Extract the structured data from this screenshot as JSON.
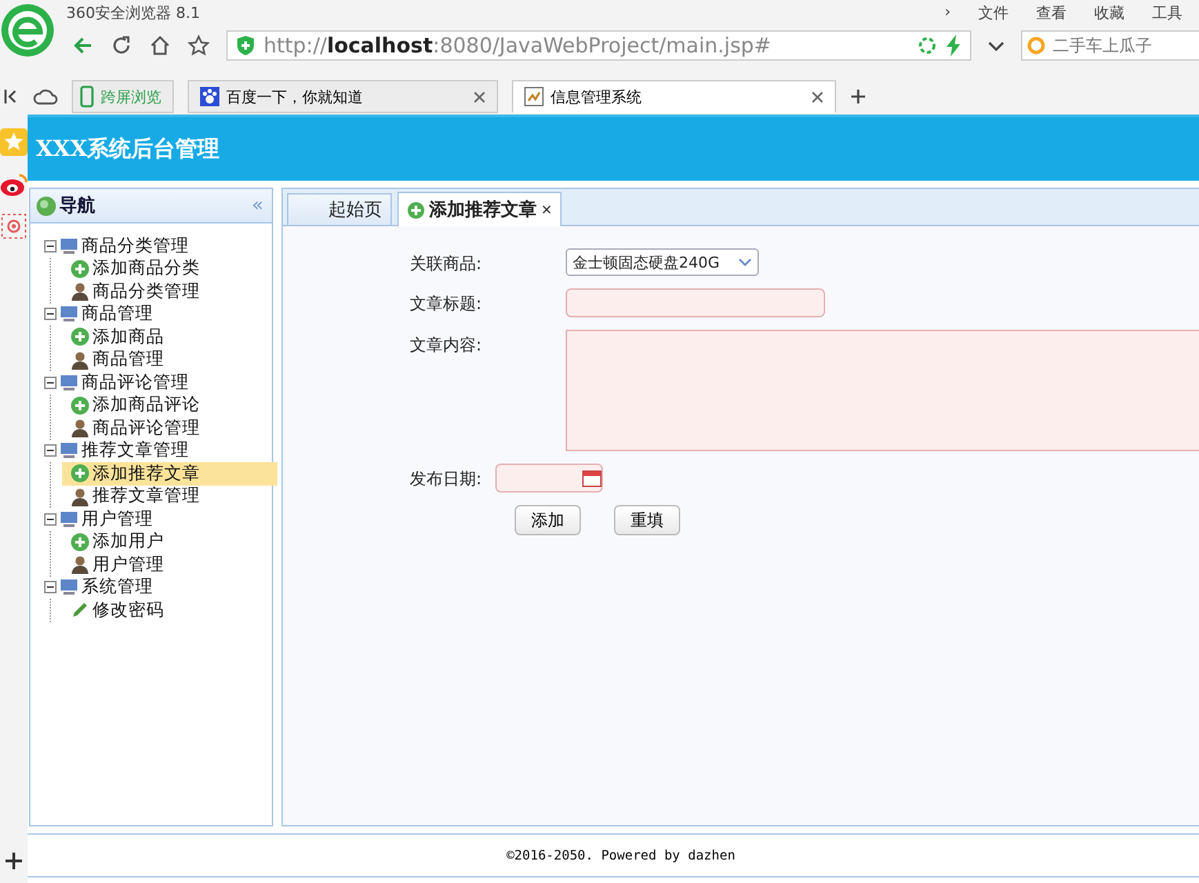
{
  "browser": {
    "title": "360安全浏览器 8.1",
    "chevron": "›",
    "menu": [
      "文件",
      "查看",
      "收藏",
      "工具"
    ],
    "url": "http://**localhost**:8080/JavaWebProject/main.jsp#",
    "search": {
      "placeholder": "二手车上瓜子"
    },
    "tabs": [
      {
        "kind": "pinned",
        "label": "跨屏浏览",
        "selected": false
      },
      {
        "kind": "page",
        "label": "百度一下，你就知道",
        "selected": false
      },
      {
        "kind": "page",
        "label": "信息管理系统",
        "selected": true
      }
    ]
  },
  "app": {
    "title": "XXX系统后台管理",
    "nav": {
      "title": "导航",
      "collapse": "«",
      "tree": [
        {
          "label": "商品分类管理",
          "expanded": true,
          "children": [
            {
              "kind": "add",
              "label": "添加商品分类",
              "selected": false
            },
            {
              "kind": "manage",
              "label": "商品分类管理",
              "selected": false
            }
          ]
        },
        {
          "label": "商品管理",
          "expanded": true,
          "children": [
            {
              "kind": "add",
              "label": "添加商品",
              "selected": false
            },
            {
              "kind": "manage",
              "label": "商品管理",
              "selected": false
            }
          ]
        },
        {
          "label": "商品评论管理",
          "expanded": true,
          "children": [
            {
              "kind": "add",
              "label": "添加商品评论",
              "selected": false
            },
            {
              "kind": "manage",
              "label": "商品评论管理",
              "selected": false
            }
          ]
        },
        {
          "label": "推荐文章管理",
          "expanded": true,
          "children": [
            {
              "kind": "add",
              "label": "添加推荐文章",
              "selected": true
            },
            {
              "kind": "manage",
              "label": "推荐文章管理",
              "selected": false
            }
          ]
        },
        {
          "label": "用户管理",
          "expanded": true,
          "children": [
            {
              "kind": "add",
              "label": "添加用户",
              "selected": false
            },
            {
              "kind": "manage",
              "label": "用户管理",
              "selected": false
            }
          ]
        },
        {
          "label": "系统管理",
          "expanded": true,
          "children": [
            {
              "kind": "edit",
              "label": "修改密码",
              "selected": false
            }
          ]
        }
      ]
    },
    "tabs": [
      {
        "label": "起始页",
        "selected": false
      },
      {
        "label": "添加推荐文章",
        "selected": true,
        "close": "×"
      }
    ],
    "form": {
      "fields": [
        {
          "kind": "select",
          "label": "关联商品:",
          "value": "金士顿固态硬盘240G"
        },
        {
          "kind": "text",
          "label": "文章标题:"
        },
        {
          "kind": "textarea",
          "label": "文章内容:"
        },
        {
          "kind": "date",
          "label": "发布日期:"
        }
      ],
      "buttons": [
        "添加",
        "重填"
      ]
    },
    "footer": "©2016-2050. Powered by dazhen"
  }
}
